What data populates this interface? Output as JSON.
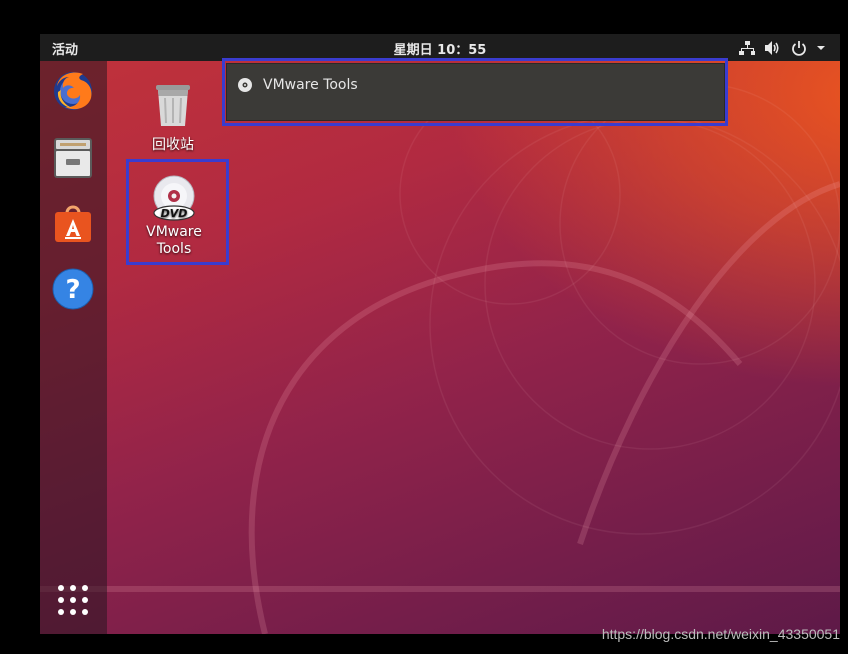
{
  "topbar": {
    "activities_label": "活动",
    "clock": "星期日 10：55",
    "tray_icons": [
      "network-icon",
      "volume-icon",
      "power-icon",
      "menu-arrow-icon"
    ]
  },
  "dock": {
    "items": [
      {
        "name": "firefox-icon"
      },
      {
        "name": "files-icon"
      },
      {
        "name": "software-center-icon"
      },
      {
        "name": "help-icon"
      }
    ],
    "show_apps_icon": "app-grid-icon"
  },
  "desktop": {
    "trash_label": "回收站",
    "dvd_label_line1": "VMware",
    "dvd_label_line2": "Tools"
  },
  "notification": {
    "text": "VMware Tools",
    "icon": "disc-icon"
  },
  "highlight_color": "#3a3ccf",
  "watermark": "https://blog.csdn.net/weixin_43350051"
}
